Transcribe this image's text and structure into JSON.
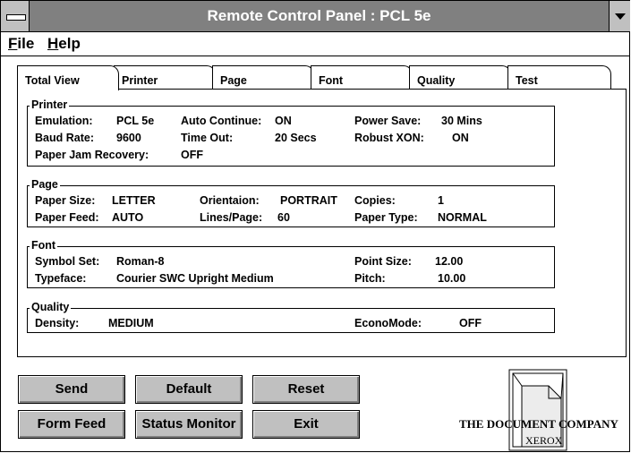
{
  "window": {
    "title": "Remote Control Panel : PCL 5e"
  },
  "menu": {
    "file_u": "F",
    "file_rest": "ile",
    "help_u": "H",
    "help_rest": "elp"
  },
  "tabs": [
    "Total View",
    "Printer",
    "Page",
    "Font",
    "Quality",
    "Test"
  ],
  "groups": {
    "printer": {
      "label": "Printer",
      "emulation_label": "Emulation:",
      "emulation_value": "PCL 5e",
      "auto_continue_label": "Auto Continue:",
      "auto_continue_value": "ON",
      "power_save_label": "Power Save:",
      "power_save_value": "30 Mins",
      "baud_rate_label": "Baud Rate:",
      "baud_rate_value": "9600",
      "time_out_label": "Time Out:",
      "time_out_value": "20 Secs",
      "robust_xon_label": "Robust XON:",
      "robust_xon_value": "ON",
      "paper_jam_label": "Paper Jam Recovery:",
      "paper_jam_value": "OFF"
    },
    "page": {
      "label": "Page",
      "paper_size_label": "Paper Size:",
      "paper_size_value": "LETTER",
      "orientation_label": "Orientaion:",
      "orientation_value": "PORTRAIT",
      "copies_label": "Copies:",
      "copies_value": "1",
      "paper_feed_label": "Paper Feed:",
      "paper_feed_value": "AUTO",
      "lines_page_label": "Lines/Page:",
      "lines_page_value": "60",
      "paper_type_label": "Paper Type:",
      "paper_type_value": "NORMAL"
    },
    "font": {
      "label": "Font",
      "symbol_set_label": "Symbol Set:",
      "symbol_set_value": "Roman-8",
      "point_size_label": "Point Size:",
      "point_size_value": "12.00",
      "typeface_label": "Typeface:",
      "typeface_value": "Courier SWC Upright Medium",
      "pitch_label": "Pitch:",
      "pitch_value": "10.00"
    },
    "quality": {
      "label": "Quality",
      "density_label": "Density:",
      "density_value": "MEDIUM",
      "econo_label": "EconoMode:",
      "econo_value": "OFF"
    }
  },
  "buttons": {
    "send": "Send",
    "default": "Default",
    "reset": "Reset",
    "form_feed": "Form Feed",
    "status_monitor": "Status Monitor",
    "exit": "Exit"
  },
  "logo": {
    "tagline": "THE DOCUMENT COMPANY",
    "brand": "XEROX"
  },
  "icons": [
    "system-menu-icon",
    "dropdown-arrow-icon",
    "document-logo-icon"
  ]
}
